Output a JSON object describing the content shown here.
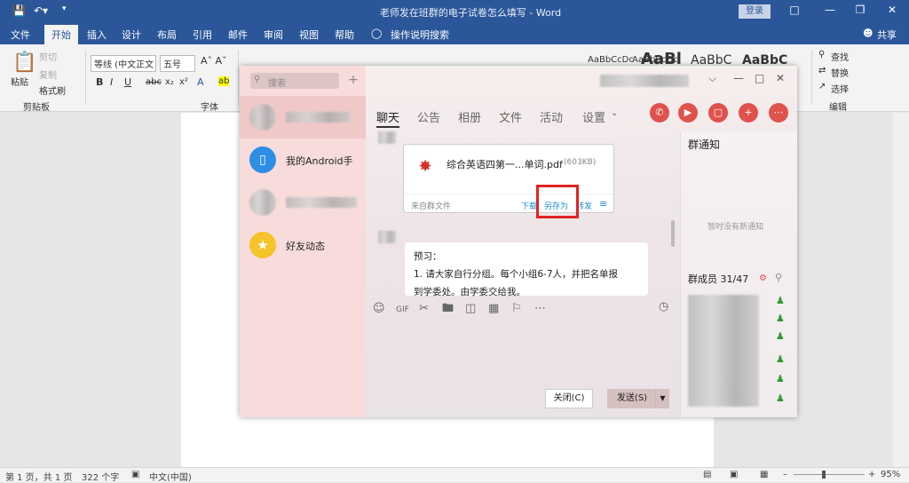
{
  "word": {
    "title": "老师发在班群的电子试卷怎么填写 - Word",
    "login": "登录",
    "share": "共享",
    "tabs": [
      "文件",
      "开始",
      "插入",
      "设计",
      "布局",
      "引用",
      "邮件",
      "审阅",
      "视图",
      "帮助",
      "操作说明搜索"
    ],
    "clipboard": {
      "paste": "粘贴",
      "cut": "剪切",
      "copy": "复制",
      "format_painter": "格式刷",
      "group": "剪贴板"
    },
    "font": {
      "name": "等线 (中文正文",
      "size": "五号",
      "group": "字体"
    },
    "styles": [
      "AaBbCcDc",
      "AaBbCcDc",
      "AaBl",
      "AaBbC",
      "AaBbC"
    ],
    "editing": {
      "find": "查找",
      "replace": "替换",
      "select": "选择",
      "group": "编辑"
    },
    "status": {
      "page": "第 1 页，共 1 页",
      "words": "322 个字",
      "lang": "中文(中国)",
      "zoom": "95%"
    }
  },
  "chat": {
    "search_placeholder": "搜索",
    "contacts": [
      {
        "name": ""
      },
      {
        "name": "我的Android手"
      },
      {
        "name": ""
      },
      {
        "name": "好友动态"
      }
    ],
    "nav_tabs": [
      "聊天",
      "公告",
      "相册",
      "文件",
      "活动",
      "设置"
    ],
    "file": {
      "name": "综合英语四第一...单词.pdf",
      "size": "(603KB)",
      "source": "来自群文件",
      "download": "下载",
      "save_as": "另存为",
      "forward": "转发"
    },
    "message": {
      "lines": [
        "预习：",
        "1.      请大家自行分组。每个小组6-7人，并把名单报",
        "到学委处。由学委交给我。"
      ]
    },
    "buttons": {
      "close": "关闭(C)",
      "send": "发送(S)"
    },
    "notice": {
      "title": "群通知",
      "empty": "暂时没有新通知"
    },
    "members": {
      "label": "群成员 31/47"
    },
    "colors": {
      "highlight": "#e02323",
      "word_blue": "#2b579a",
      "pdf_red": "#d93025"
    }
  }
}
